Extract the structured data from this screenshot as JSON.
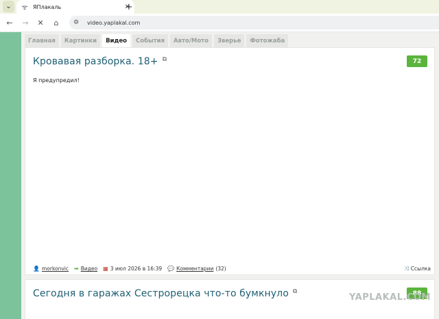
{
  "browser": {
    "tab": {
      "title": "ЯПлакаль",
      "favicon_icon": "wifi-icon"
    },
    "url": "video.yaplakal.com"
  },
  "site_nav": [
    "Главная",
    "Картинки",
    "Видео",
    "События",
    "Авто/Мото",
    "Зверье",
    "Фотожаба"
  ],
  "site_nav_active": "Видео",
  "posts": [
    {
      "title": "Кровавая разборка. 18+",
      "rating": "72",
      "body": "Я предупредил!",
      "author": "morkonvic",
      "section": "Видео",
      "date": "3 июл 2026 в 16:39",
      "comments_label": "Комментарии",
      "comments_count": "(32)",
      "share_label": "Ссылка"
    },
    {
      "title": "Сегодня в гаражах Сестрорецка что-то бумкнуло",
      "rating": "88"
    }
  ],
  "watermark": "YAPLAKAL.COM",
  "colors": {
    "accent": "#1f5f73",
    "rating": "#5bb43c",
    "side": "#7cc39c"
  }
}
